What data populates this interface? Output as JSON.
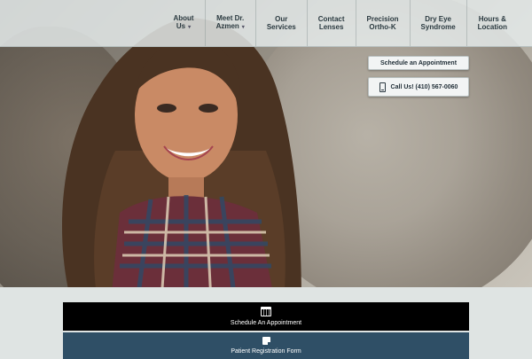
{
  "nav": {
    "items": [
      {
        "line1": "About",
        "line2": "Us",
        "dropdown": true
      },
      {
        "line1": "Meet Dr.",
        "line2": "Azmen",
        "dropdown": true
      },
      {
        "line1": "Our",
        "line2": "Services",
        "dropdown": false
      },
      {
        "line1": "Contact",
        "line2": "Lenses",
        "dropdown": false
      },
      {
        "line1": "Precision",
        "line2": "Ortho-K",
        "dropdown": false
      },
      {
        "line1": "Dry Eye",
        "line2": "Syndrome",
        "dropdown": false
      },
      {
        "line1": "Hours &",
        "line2": "Location",
        "dropdown": false
      }
    ]
  },
  "hero": {
    "schedule_label": "Schedule an Appointment",
    "call_label": "Call Us! (410) 567-0060",
    "phone_icon": "phone-icon"
  },
  "actions": {
    "appointment_label": "Schedule An Appointment",
    "appointment_icon": "calendar-icon",
    "registration_label": "Patient Registration Form",
    "registration_icon": "form-icon"
  },
  "colors": {
    "nav_bg": "#e8eeee",
    "appointment_bar": "#000000",
    "registration_bar": "#2f4f66",
    "page_bg": "#dfe4e3"
  }
}
